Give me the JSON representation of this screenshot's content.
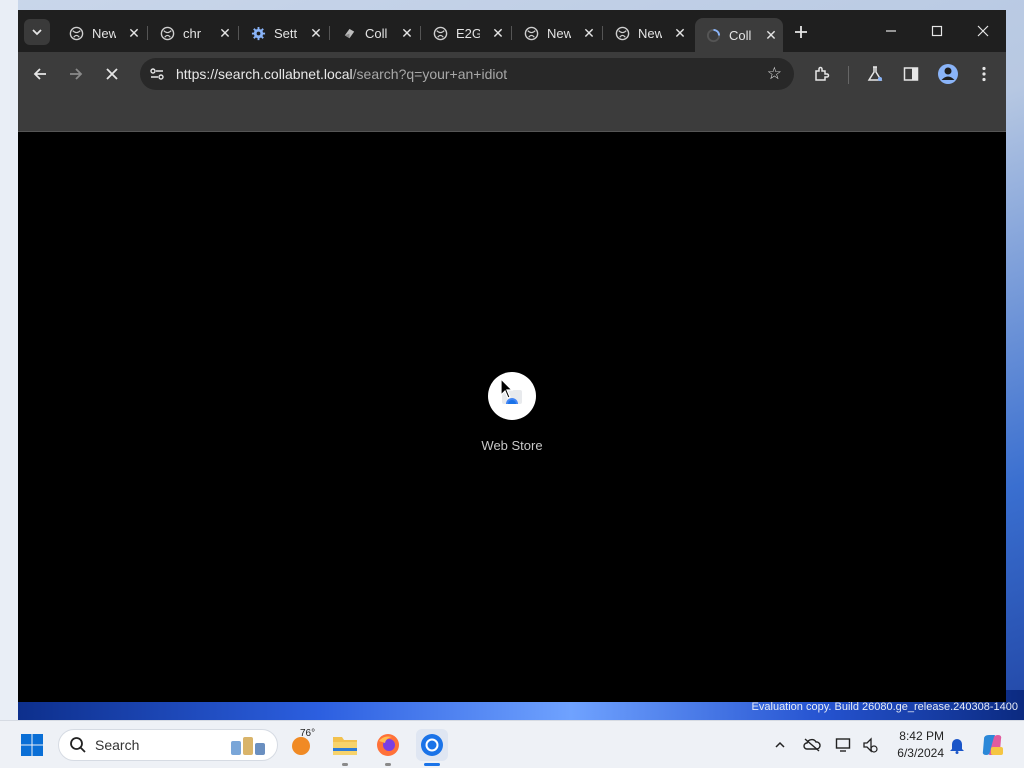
{
  "browser": {
    "tabs": [
      {
        "title": "New",
        "icon": "globe-icon"
      },
      {
        "title": "chr",
        "icon": "globe-icon"
      },
      {
        "title": "Sett",
        "icon": "gear-icon"
      },
      {
        "title": "Coll",
        "icon": "collabnet-icon"
      },
      {
        "title": "E2G",
        "icon": "globe-icon"
      },
      {
        "title": "New",
        "icon": "globe-icon"
      },
      {
        "title": "New",
        "icon": "globe-icon"
      },
      {
        "title": "Coll",
        "icon": "loading-icon"
      }
    ],
    "address_bar": {
      "host": "https://search.collabnet.local",
      "path": "/search?q=your+an+idiot"
    },
    "page": {
      "shortcut_label": "Web Store"
    },
    "colors": {
      "tabbar": "#1f1f1f",
      "toolbar": "#3c3c3c",
      "content": "#000000",
      "accent": "#8ab4f8"
    }
  },
  "taskbar": {
    "search_placeholder": "Search",
    "weather_temp": "76°",
    "time": "8:42 PM",
    "date": "6/3/2024"
  },
  "desktop": {
    "eval_text": "Evaluation copy. Build 26080.ge_release.240308-1400"
  }
}
